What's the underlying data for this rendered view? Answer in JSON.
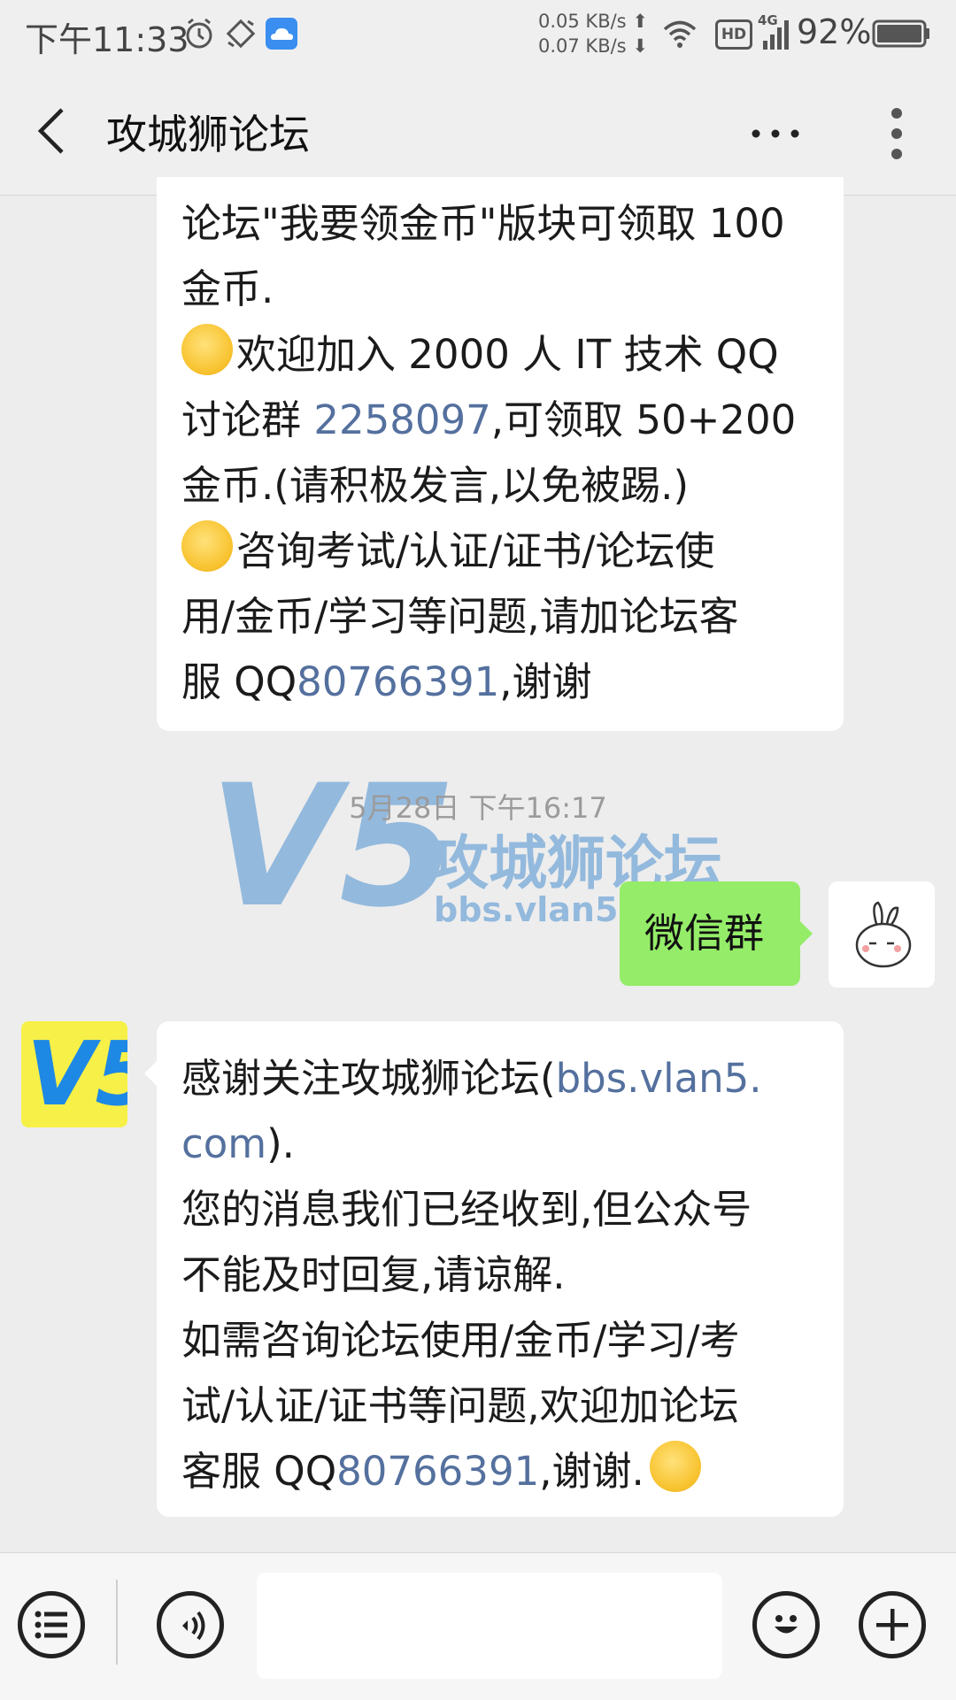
{
  "status": {
    "time": "下午11:33",
    "net_up": "0.05 KB/s",
    "net_down": "0.07 KB/s",
    "hd": "HD",
    "lte": "4G",
    "battery": "92%",
    "icons": [
      "alarm-icon",
      "rotate-icon",
      "cloud-icon",
      "wifi-icon",
      "signal-icon",
      "battery-icon"
    ]
  },
  "header": {
    "title": "攻城狮论坛",
    "back_icon": "back-arrow-icon",
    "more_icon": "more-dots-icon",
    "menu_icon": "vertical-dots-icon"
  },
  "messages": {
    "first": {
      "l1": "论坛\"我要领金币\"版块可领取 100",
      "l2": "金币.",
      "l3": "欢迎加入 2000 人 IT 技术 QQ",
      "l4a": "讨论群 ",
      "l4link": "2258097",
      "l4b": ",可领取 50+200",
      "l5": "金币.(请积极发言,以免被踢.)",
      "l6": "咨询考试/认证/证书/论坛使",
      "l7": "用/金币/学习等问题,请加论坛客",
      "l8a": "服 QQ",
      "l8link": "80766391",
      "l8b": ",谢谢"
    },
    "timestamp": "5月28日 下午16:17",
    "sent": "微信群",
    "second": {
      "l1a": "感谢关注攻城狮论坛(",
      "l1link": "bbs.vlan5.",
      "l2link": "com",
      "l2b": ").",
      "l3": "您的消息我们已经收到,但公众号",
      "l4": "不能及时回复,请谅解.",
      "l5": "如需咨询论坛使用/金币/学习/考",
      "l6": "试/认证/证书等问题,欢迎加论坛",
      "l7a": "客服 QQ",
      "l7link": "80766391",
      "l7b": ",谢谢."
    }
  },
  "watermark": {
    "logo": "V5",
    "name": "攻城狮论坛",
    "url": "bbs.vlan5.com"
  },
  "colors": {
    "link": "#54709e",
    "sent_bubble": "#95ec69",
    "background": "#ededed"
  },
  "bottombar": {
    "menu_icon": "list-menu-icon",
    "voice_icon": "voice-icon",
    "emoji_icon": "emoji-icon",
    "plus_icon": "plus-icon"
  }
}
